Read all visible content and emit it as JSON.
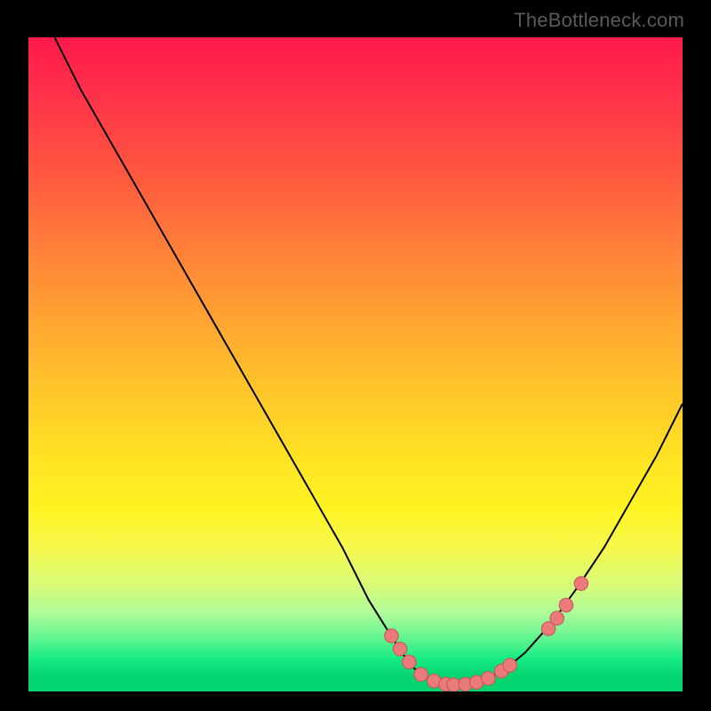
{
  "watermark": "TheBottleneck.com",
  "colors": {
    "background": "#000000",
    "gradient_top": "#ff1a4b",
    "gradient_mid": "#ffe423",
    "gradient_bottom": "#05d571",
    "curve": "#000000",
    "marker_fill": "#eb7b7b",
    "marker_stroke": "#c95757"
  },
  "chart_data": {
    "type": "line",
    "title": "",
    "xlabel": "",
    "ylabel": "",
    "xlim": [
      0,
      100
    ],
    "ylim": [
      0,
      100
    ],
    "series": [
      {
        "name": "bottleneck-curve",
        "x": [
          4,
          6,
          8,
          12,
          16,
          20,
          24,
          28,
          32,
          36,
          40,
          44,
          48,
          52,
          54.5,
          57,
          59,
          61,
          63,
          65,
          67,
          70,
          73,
          76,
          80,
          84,
          88,
          92,
          96,
          100
        ],
        "y": [
          100,
          96,
          92,
          85,
          78,
          71,
          64,
          57,
          50,
          43,
          36,
          29,
          22,
          14,
          10,
          6,
          3.5,
          2,
          1.3,
          1,
          1.1,
          1.8,
          3.5,
          6,
          10.5,
          16,
          22,
          29,
          36,
          44
        ]
      }
    ],
    "markers": {
      "name": "highlighted-points",
      "x": [
        55.5,
        56.8,
        58.2,
        60.0,
        62.0,
        63.8,
        65.0,
        66.8,
        68.5,
        70.3,
        72.3,
        73.6,
        79.5,
        80.8,
        82.2,
        84.5
      ],
      "y": [
        8.5,
        6.5,
        4.5,
        2.6,
        1.6,
        1.1,
        1.0,
        1.1,
        1.4,
        2.0,
        3.1,
        4.0,
        9.6,
        11.2,
        13.2,
        16.5
      ]
    }
  }
}
